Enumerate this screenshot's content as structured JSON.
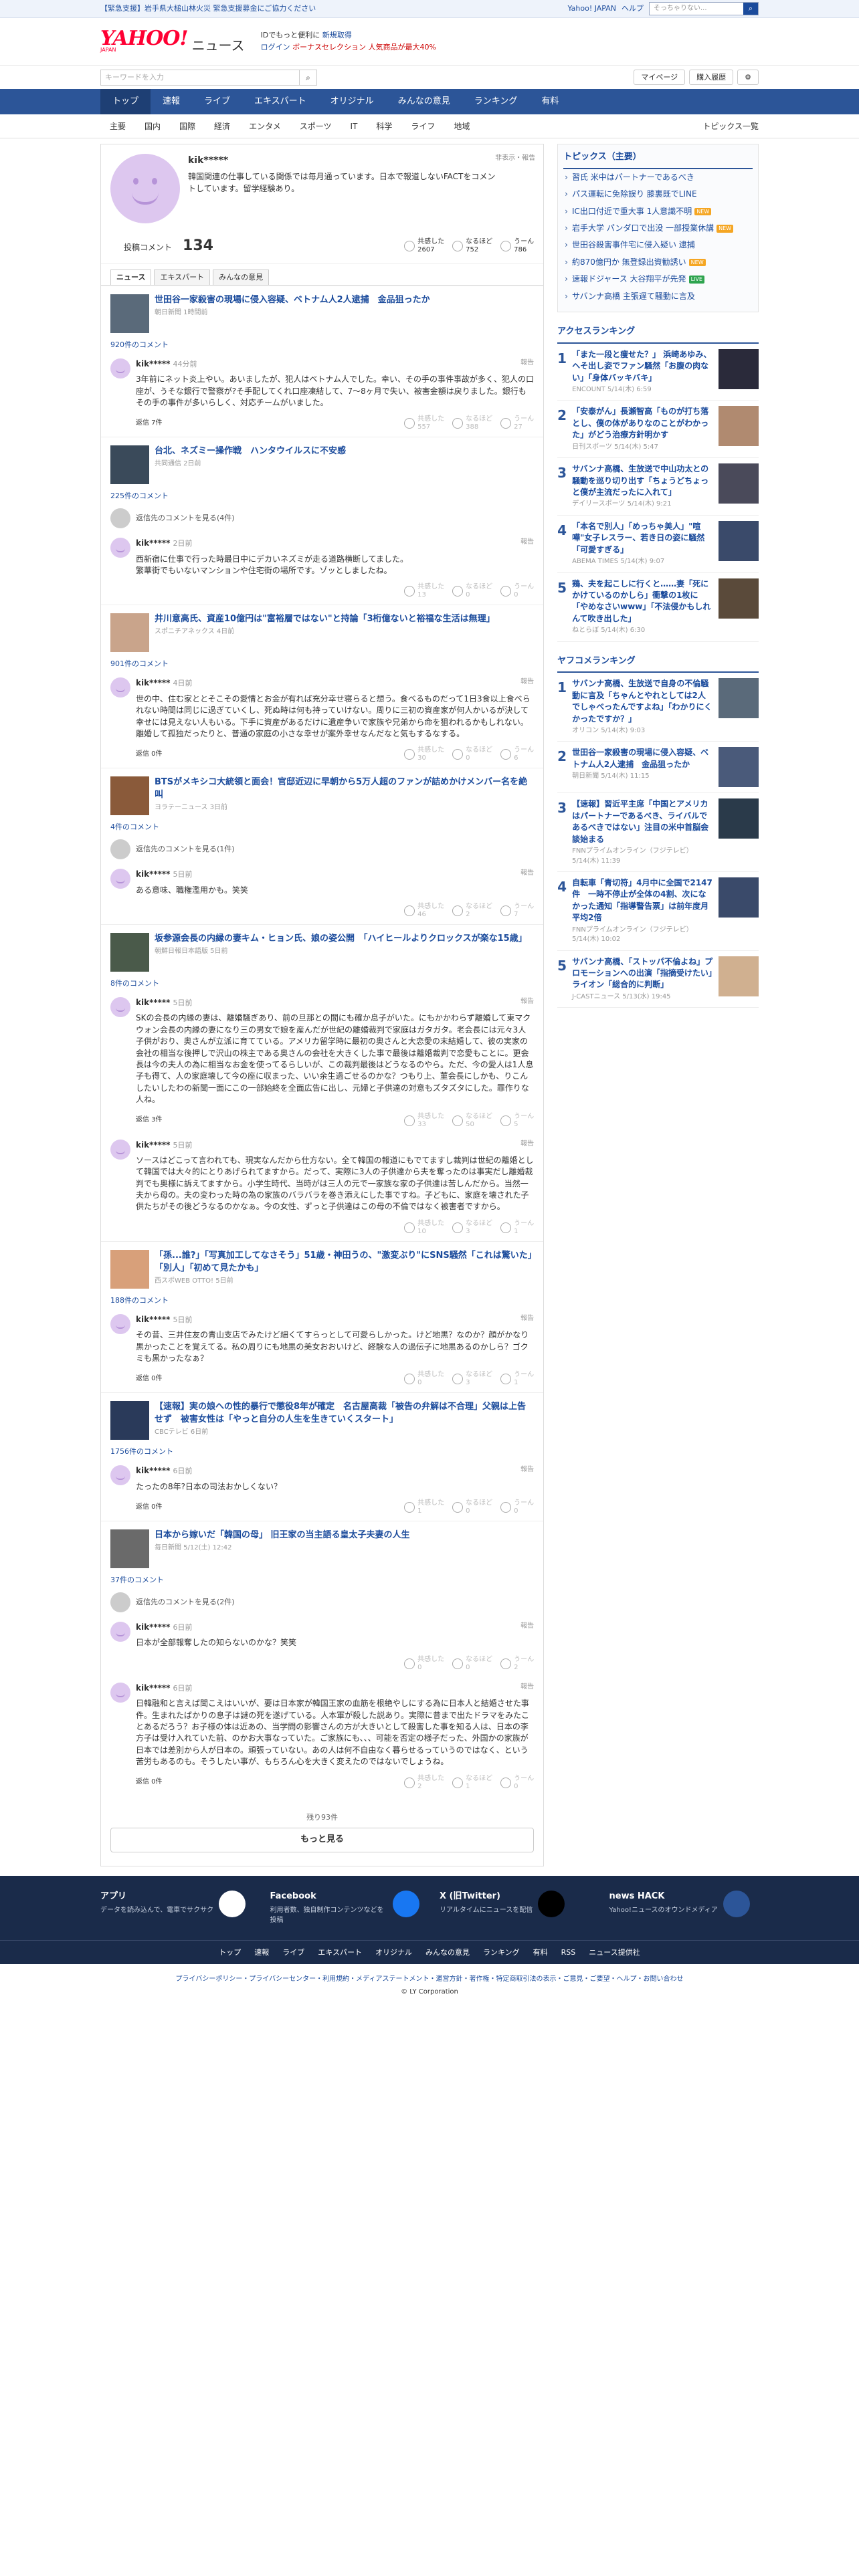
{
  "topbar": {
    "emergency": "【緊急支援】岩手県大槌山林火災 緊急支援募金にご協力ください",
    "japan": "Yahoo! JAPAN",
    "help": "ヘルプ",
    "search_placeholder": "ウェブ検索",
    "search_text": "そっちゃりない..."
  },
  "header": {
    "logo": "YAHOO!",
    "logo_sub": "JAPAN",
    "service": "ニュース",
    "promo1": "IDでもっと便利に",
    "promo1_link": "新規取得",
    "login": "ログイン",
    "promo2": "ボーナスセレクション 人気商品が最大40%"
  },
  "bar2": {
    "search_placeholder": "キーワードを入力",
    "mypage": "マイページ",
    "purchase": "購入履歴"
  },
  "gnav": [
    "トップ",
    "速報",
    "ライブ",
    "エキスパート",
    "オリジナル",
    "みんなの意見",
    "ランキング",
    "有料"
  ],
  "snav": [
    "主要",
    "国内",
    "国際",
    "経済",
    "エンタメ",
    "スポーツ",
    "IT",
    "科学",
    "ライフ",
    "地域"
  ],
  "snav_right": "トピックス一覧",
  "profile": {
    "name": "kik*****",
    "bio": "韓国関連の仕事している関係では毎月通っています。日本で報道しないFACTをコメントしています。留学経験あり。",
    "report": "非表示・報告",
    "comment_label": "投稿コメント",
    "comment_count": "134",
    "reactions": [
      {
        "label": "共感した",
        "value": "2607"
      },
      {
        "label": "なるほど",
        "value": "752"
      },
      {
        "label": "うーん",
        "value": "786"
      }
    ]
  },
  "tabs": [
    "ニュース",
    "エキスパート",
    "みんなの意見"
  ],
  "reaction_labels": [
    "共感した",
    "なるほど",
    "うーん"
  ],
  "labels": {
    "report": "報告",
    "reply": "返信"
  },
  "articles": [
    {
      "title": "世田谷一家殺害の現場に侵入容疑、ベトナム人2人逮捕　金品狙ったか",
      "source": "朝日新聞 1時間前",
      "comments_link": "920件のコメント",
      "thumb": "#5a6a7a",
      "comments": [
        {
          "user": "kik*****",
          "time": "44分前",
          "text": "3年前にネット炎上やい。あいましたが、犯人はベトナム人でした。幸い、その手の事件事故が多く、犯人の口座が、うそな銀行で警察が?そ手配してくれ口座凍結して、7〜8ヶ月で失い、被害金額は戻りました。銀行もその手の事件が多いらしく、対応チームがいました。",
          "reply": "返信 7件",
          "r": [
            "557",
            "388",
            "27"
          ]
        }
      ]
    },
    {
      "title": "台北、ネズミー操作戦　ハンタウイルスに不安感",
      "source": "共同通信 2日前",
      "comments_link": "225件のコメント",
      "thumb": "#3a4a5a",
      "reply_view": "返信先のコメントを見る(4件)",
      "comments": [
        {
          "user": "kik*****",
          "time": "2日前",
          "text": "西新宿に仕事で行った時最日中にデカいネズミが走る道路横断してました。\n繁華街でもいないマンションや住宅街の場所です。ゾッとしましたね。",
          "reply": "",
          "r": [
            "13",
            "0",
            "0"
          ]
        }
      ]
    },
    {
      "title": "井川意高氏、資産10億円は\"富裕層ではない\"と持論「3桁億ないと裕福な生活は無理」",
      "source": "スポニチアネックス 4日前",
      "comments_link": "901件のコメント",
      "thumb": "#c9a48b",
      "comments": [
        {
          "user": "kik*****",
          "time": "4日前",
          "text": "世の中、住む家ととそこその愛情とお金が有れば充分幸せ寝らると想う。食べるものだって1日3食以上食べられない時間は同じに過ぎていくし、死ぬ時は何も持っていけない。周りに三初の資産家が何人かいるが決して幸せには見えない人もいる。下手に資産があるだけに遺産争いで家族や兄弟から命を狙われるかもしれない。離婚して孤独だったりと、普通の家庭の小さな幸せが案外幸せなんだなと気もするなする。",
          "reply": "返信 0件",
          "r": [
            "30",
            "0",
            "6"
          ]
        }
      ]
    },
    {
      "title": "BTSがメキシコ大統領と面会！官邸近辺に早朝から5万人超のファンが詰めかけメンバー名を絶叫",
      "source": "ヨラテーニュース 3日前",
      "comments_link": "4件のコメント",
      "thumb": "#8a5a3a",
      "reply_view": "返信先のコメントを見る(1件)",
      "comments": [
        {
          "user": "kik*****",
          "time": "5日前",
          "text": "ある意味、職権濫用かも。笑笑",
          "reply": "",
          "r": [
            "46",
            "2",
            "7"
          ]
        }
      ]
    },
    {
      "title": "坂参源会長の内縁の妻キム・ヒョン氏、娘の姿公開　「ハイヒールよりクロックスが楽な15歳」",
      "source": "朝鮮日報日本語版 5日前",
      "comments_link": "8件のコメント",
      "thumb": "#4a5a4a",
      "comments": [
        {
          "user": "kik*****",
          "time": "5日前",
          "text": "SKの会長の内縁の妻は、離婚騒ぎあり、前の旦那との間にも確か息子がいた。にもかかわらず離婚して東マクウォン会長の内縁の妻になり三の男女で娘を産んだが世紀の離婚裁判で家庭はガタガタ。老会長には元々3人子供がおり、奥さんが立派に育てている。アメリカ留学時に最初の奥さんと大恋愛の末結婚して、彼の実家の会社の相当な後押しで沢山の株主である奥さんの会社を大きくした事で最後は離婚裁判で恋愛もことに。更会長は今の夫人の為に相当なお金を使ってるらしいが、この裁判最後はどうなるのやら。ただ、今の愛人は1人息子も得て、人の家庭壊して今の座に収まった、いい余生過ごせるのかな？つもり上、菫会長にしかも、りこんしたいしたわの新聞一面にこの一部始終を全面広告に出し、元婦と子供達の対意もズタズタにした。罪作りな人ね。",
          "reply": "返信 3件",
          "r": [
            "33",
            "50",
            "5"
          ]
        },
        {
          "user": "kik*****",
          "time": "5日前",
          "text": "ソースはどこって言われても、現実なんだから仕方ない。全て韓国の報道にもでてますし裁判は世紀の離婚として韓国では大々的にとりあげられてますから。だって、実際に3人の子供達から夫を奪ったのは事実だし離婚裁判でも奥様に訴えてますから。小学生時代、当時がは三人の元で一家族な家の子供達は苦しんだから。当然一夫から母の。夫の変わった時の為の家族のバラバラを巻き添えにした事ですね。子どもに、家庭を壊された子供たちがその後どうなるのかなぁ。今の女性、ずっと子供達はこの母の不倫ではなく被害者ですから。",
          "reply": "",
          "r": [
            "10",
            "3",
            "1"
          ]
        }
      ]
    },
    {
      "title": "「孫...誰?」「写真加工してなさそう」51歳・神田うの、\"激変ぶり\"にSNS騒然「これは驚いた」「別人」「初めて見たかも」",
      "source": "西スポWEB OTTO! 5日前",
      "comments_link": "188件のコメント",
      "thumb": "#d8a07a",
      "comments": [
        {
          "user": "kik*****",
          "time": "5日前",
          "text": "その昔、三井住友の青山支店でみたけど細くてすらっとして可愛らしかった。けど地黒？なのか？顔がかなり黒かったことを覚えてる。私の周りにも地黒の美女おおいけど、経験な人の過伝子に地黒あるのかしら？ゴクミも黒かったなぁ？",
          "reply": "返信 0件",
          "r": [
            "0",
            "3",
            "1"
          ]
        }
      ]
    },
    {
      "title": "【速報】実の娘への性的暴行で懲役8年が確定　名古屋高裁「被告の弁解は不合理」父親は上告せず　被害女性は「やっと自分の人生を生きていくスタート」",
      "source": "CBCテレビ 6日前",
      "comments_link": "1756件のコメント",
      "thumb": "#2a3a5a",
      "comments": [
        {
          "user": "kik*****",
          "time": "6日前",
          "text": "たったの8年?日本の司法おかしくない？",
          "reply": "返信 0件",
          "r": [
            "1",
            "0",
            "0"
          ]
        }
      ]
    },
    {
      "title": "日本から嫁いだ「韓国の母」 旧王家の当主語る皇太子夫妻の人生",
      "source": "毎日新聞 5/12(土) 12:42",
      "comments_link": "37件のコメント",
      "thumb": "#6a6a6a",
      "reply_view": "返信先のコメントを見る(2件)",
      "comments": [
        {
          "user": "kik*****",
          "time": "6日前",
          "text": "日本が全部報奪したの知らないのかな？笑笑",
          "reply": "",
          "r": [
            "0",
            "0",
            "2"
          ]
        },
        {
          "user": "kik*****",
          "time": "6日前",
          "text": "日韓融和と言えば聞こえはいいが、要は日本家が韓国王家の血筋を根絶やしにする為に日本人と結婚させた事件。生まれたばかりの息子は謎の死を遂げている。人本軍が殺した説あり。実際に昔まで出たドラマをみたことあるだろう？お子様の体は近あの、当学問の影響さんの方が大きいとして殺害した事を知る人は、日本の李方子は受け入れていた前、のかお大事なっていた。ご家族にも、、、可能を否定の様子だった、外国かの家族が日本では差別から人が日本の。頑張っていない。あの人は何不自由なく暮らせるっていうのではなく、という苦労もあるのも。そうしたい事が、もちろん心を大きく変えたのではないでしょうね。",
          "reply": "返信 0件",
          "r": [
            "2",
            "1",
            "0"
          ]
        }
      ]
    }
  ],
  "more": {
    "rest": "残り93件",
    "button": "もっと見る"
  },
  "side": {
    "topics_title": "トピックス（主要）",
    "topics": [
      {
        "t": "習氏 米中はパートナーであるべき",
        "b": ""
      },
      {
        "t": "パス運転に免除誤り 膝裏既でLINE",
        "b": ""
      },
      {
        "t": "IC出口付近で重大事 1人意識不明",
        "b": "new"
      },
      {
        "t": "岩手大学 パンダ口で出没 一部授業休講",
        "b": "new"
      },
      {
        "t": "世田谷殺害事件宅に侵入疑い 逮捕",
        "b": ""
      },
      {
        "t": "約870億円か 無登録出資勧誘い",
        "b": "new"
      },
      {
        "t": "速報ドジャース 大谷翔平が先発",
        "b": "live"
      },
      {
        "t": "サバンナ高橋 主張遅て騒動に言及",
        "b": ""
      }
    ],
    "access_title": "アクセスランキング",
    "access": [
      {
        "t": "「また一段と痩せた？」 浜崎あゆみ、ヘそ出し姿でファン騒然「お腹の肉ない」「身体バッキバキ」",
        "s": "ENCOUNT 5/14(木) 6:59",
        "c": "#2a2a3a"
      },
      {
        "t": "「安泰がん」長瀬智高「ものが打ち落とし、僕の体がありなのことがわかった」がどう治療方針明かす",
        "s": "日刊スポーツ 5/14(木) 5:47",
        "c": "#b08a70"
      },
      {
        "t": "サバンナ高橋、生放送で中山功太との騒動を巡り切り出す「ちょうどちょっと僕が主流だったに入れて」",
        "s": "デイリースポーツ 5/14(木) 9:21",
        "c": "#4a4a5a"
      },
      {
        "t": "「本名で別人」「めっちゃ美人」\"喧嘩\"女子レスラー、若き日の姿に騒然「可愛すぎる」",
        "s": "ABEMA TIMES 5/14(木) 9:07",
        "c": "#3a4a6a"
      },
      {
        "t": "鶏、夫を起こしに行くと……妻「死にかけているのかしら」衝撃の1枚に「やめなさいwww」「不法侵かもしれんて吹き出した」",
        "s": "ねとらぼ 5/14(木) 6:30",
        "c": "#5a4a3a"
      }
    ],
    "yahoo_title": "ヤフコメランキング",
    "yahoo": [
      {
        "t": "サバンナ高橋、生放送で自身の不倫騒動に言及「ちゃんとやれとしては2人でしゃべったんですよね」「わかりにくかったですか？」",
        "s": "オリコン 5/14(木) 9:03",
        "c": "#5a6a7a"
      },
      {
        "t": "世田谷一家殺害の現場に侵入容疑、ベトナム人2人逮捕　金品狙ったか",
        "s": "朝日新聞 5/14(木) 11:15",
        "c": "#4a5a7a"
      },
      {
        "t": "【速報】習近平主席「中国とアメリカはパートナーであるべき、ライバルであるべきではない」注目の米中首脳会談始まる",
        "s": "FNNプライムオンライン（フジテレビ） 5/14(木) 11:39",
        "c": "#2a3a4a"
      },
      {
        "t": "自転車「青切符」4月中に全国で2147件　一時不停止が全体の4割、次になかった通知「指導警告票」は前年度月平均2倍",
        "s": "FNNプライムオンライン（フジテレビ） 5/14(木) 10:02",
        "c": "#3a4a6a"
      },
      {
        "t": "サバンナ高橋、「ストッパ不倫よね」プロモーションへの出演「指摘受けたい」ライオン「総合的に判断」",
        "s": "J-CASTニュース 5/13(水) 19:45",
        "c": "#d0b090"
      }
    ]
  },
  "apps": [
    {
      "title": "アプリ",
      "desc": "データを読み込んで、電車でサクサク",
      "color": "#fff"
    },
    {
      "title": "Facebook",
      "desc": "利用者数、独自制作コンテンツなどを投稿",
      "color": "#1877f2"
    },
    {
      "title": "X (旧Twitter)",
      "desc": "リアルタイムにニュースを配信",
      "color": "#000"
    },
    {
      "title": "news HACK",
      "desc": "Yahoo!ニュースのオウンドメディア",
      "color": "#2c5598"
    }
  ],
  "footer_nav": [
    "トップ",
    "速報",
    "ライブ",
    "エキスパート",
    "オリジナル",
    "みんなの意見",
    "ランキング",
    "有料",
    "RSS",
    "ニュース提供社"
  ],
  "legal": "プライバシーポリシー・プライバシーセンター・利用規約・メディアステートメント・運営方針・著作権・特定商取引法の表示・ご意見・ご要望・ヘルプ・お問い合わせ",
  "copyright": "© LY Corporation"
}
